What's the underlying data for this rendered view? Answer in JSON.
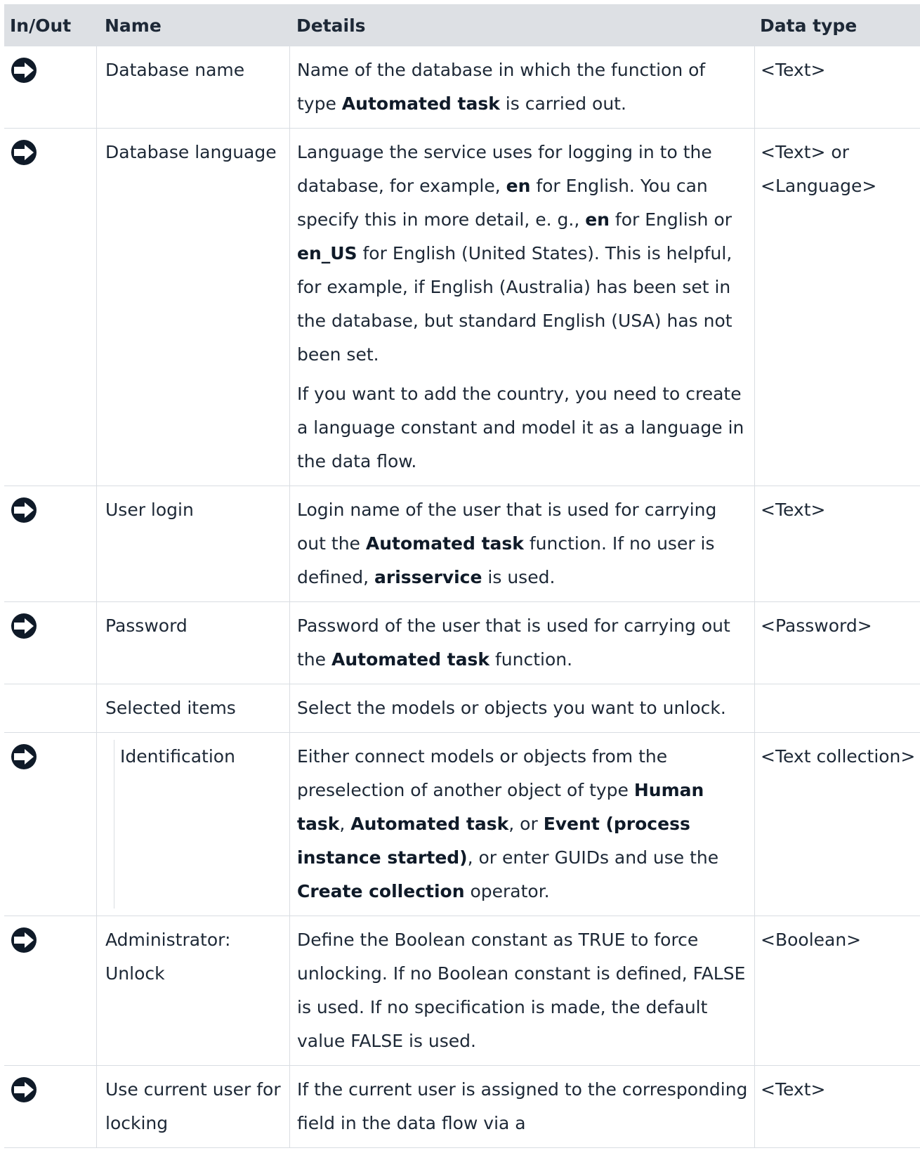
{
  "headers": {
    "inout": "In/Out",
    "name": "Name",
    "details": "Details",
    "datatype": "Data type"
  },
  "rows": [
    {
      "name": "Database name",
      "details": [
        "Name of the database in which the function of type **Automated task** is carried out."
      ],
      "type": "<Text>",
      "arrow": true
    },
    {
      "name": "Database language",
      "details": [
        "Language the service uses for logging in to the database, for example, **en** for English. You can specify this in more detail, e. g., **en** for English or **en_US** for English (United States). This is helpful, for example, if English (Australia) has been set in the database, but standard English (USA) has not been set.",
        "If you want to add the country, you need to create a language constant and model it as a language in the data flow."
      ],
      "type": "<Text> or <Language>",
      "arrow": true
    },
    {
      "name": "User login",
      "details": [
        "Login name of the user that is used for carrying out the **Automated task** function. If no user is defined, **arisservice** is used."
      ],
      "type": "<Text>",
      "arrow": true
    },
    {
      "name": "Password",
      "details": [
        "Password of the user that is used for carrying out the **Automated task** function."
      ],
      "type": "<Password>",
      "arrow": true
    },
    {
      "name": "Selected items",
      "details": [
        "Select the models or objects you want to unlock."
      ],
      "type": "",
      "arrow": false
    },
    {
      "name": "Identification",
      "details": [
        "Either connect models or objects from the preselection of another object of type **Human task**, **Automated task**, or **Event (process instance started)**, or enter GUIDs and use the **Create collection** operator."
      ],
      "type": "<Text collection>",
      "arrow": true,
      "nested": true
    },
    {
      "name": "Administrator: Unlock",
      "details": [
        "Define the Boolean constant as TRUE to force unlocking. If no Boolean constant is defined, FALSE is used. If no specification is made, the default value FALSE is used."
      ],
      "type": "<Boolean>",
      "arrow": true
    },
    {
      "name": "Use current user for locking",
      "details": [
        "If the current user is assigned to the corresponding field in the data flow via a"
      ],
      "type": "<Text>",
      "arrow": true
    }
  ],
  "icons": {
    "arrow": "input-arrow-icon"
  }
}
